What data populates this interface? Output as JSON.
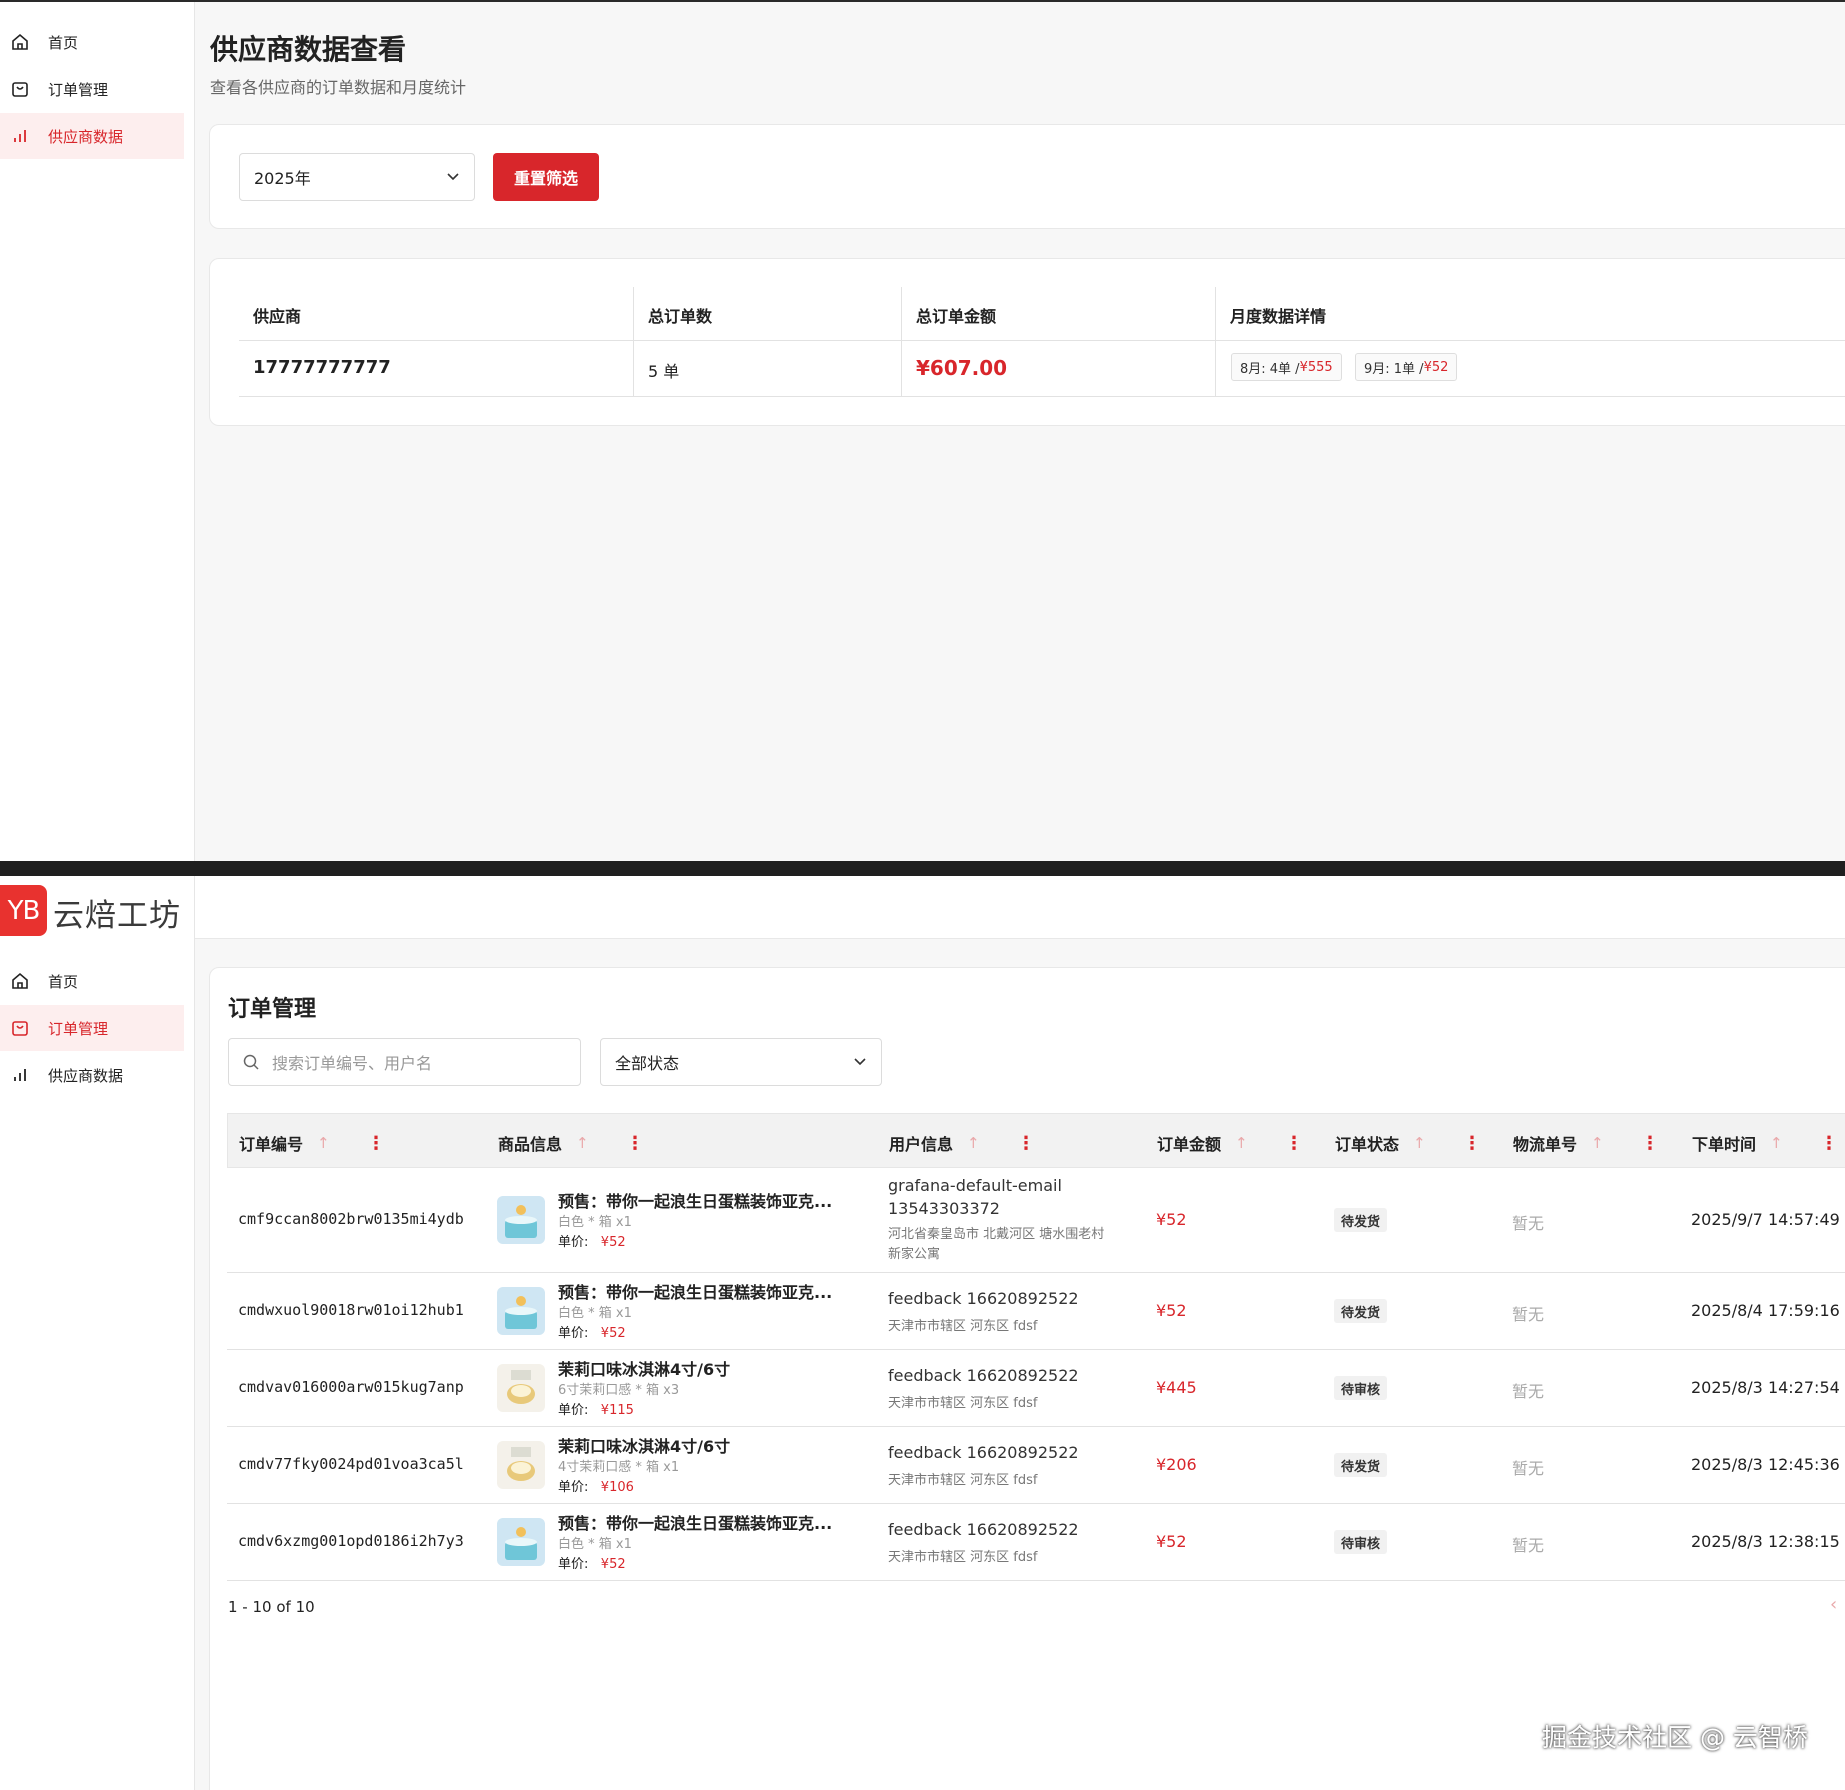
{
  "colors": {
    "accent": "#d8262b",
    "logo": "#e8322f"
  },
  "sidebar": {
    "logo_badge": "YB",
    "logo_text": "云焙工坊",
    "items": [
      {
        "label": "首页",
        "icon": "home-icon"
      },
      {
        "label": "订单管理",
        "icon": "shopping-bag-icon"
      },
      {
        "label": "供应商数据",
        "icon": "bar-chart-icon"
      }
    ]
  },
  "supplier_page": {
    "title": "供应商数据查看",
    "subtitle": "查看各供应商的订单数据和月度统计",
    "year_select": "2025年",
    "reset_button": "重置筛选",
    "columns": [
      "供应商",
      "总订单数",
      "总订单金额",
      "月度数据详情"
    ],
    "rows": [
      {
        "supplier": "17777777777",
        "total_orders": "5 单",
        "total_amount": "¥607.00",
        "monthly": [
          {
            "label": "8月: 4单 / ",
            "amount": "¥555"
          },
          {
            "label": "9月: 1单 / ",
            "amount": "¥52"
          }
        ]
      }
    ]
  },
  "order_page": {
    "title": "订单管理",
    "search_placeholder": "搜索订单编号、用户名",
    "status_select": "全部状态",
    "columns": [
      "订单编号",
      "商品信息",
      "用户信息",
      "订单金额",
      "订单状态",
      "物流单号",
      "下单时间"
    ],
    "rows": [
      {
        "id": "cmf9ccan8002brw0135mi4ydb",
        "product": "预售：带你一起浪生日蛋糕装饰亚克...",
        "variant": "白色 * 箱 x1",
        "price_label": "单价:",
        "price": "¥52",
        "user": "grafana-default-email",
        "phone": "13543303372",
        "address": "河北省秦皇岛市 北戴河区 塘水围老村",
        "address2": "新家公寓",
        "amount": "¥52",
        "status": "待发货",
        "logistics": "暂无",
        "time": "2025/9/7 14:57:49"
      },
      {
        "id": "cmdwxuol90018rw01oi12hub1",
        "product": "预售：带你一起浪生日蛋糕装饰亚克...",
        "variant": "白色 * 箱 x1",
        "price_label": "单价:",
        "price": "¥52",
        "user": "feedback 16620892522",
        "address": "天津市市辖区 河东区 fdsf",
        "amount": "¥52",
        "status": "待发货",
        "logistics": "暂无",
        "time": "2025/8/4 17:59:16"
      },
      {
        "id": "cmdvav016000arw015kug7anp",
        "product": "茉莉口味冰淇淋4寸/6寸",
        "variant": "6寸茉莉口感 * 箱 x3",
        "price_label": "单价:",
        "price": "¥115",
        "user": "feedback 16620892522",
        "address": "天津市市辖区 河东区 fdsf",
        "amount": "¥445",
        "status": "待审核",
        "logistics": "暂无",
        "time": "2025/8/3 14:27:54"
      },
      {
        "id": "cmdv77fky0024pd01voa3ca5l",
        "product": "茉莉口味冰淇淋4寸/6寸",
        "variant": "4寸茉莉口感 * 箱 x1",
        "price_label": "单价:",
        "price": "¥106",
        "user": "feedback 16620892522",
        "address": "天津市市辖区 河东区 fdsf",
        "amount": "¥206",
        "status": "待发货",
        "logistics": "暂无",
        "time": "2025/8/3 12:45:36"
      },
      {
        "id": "cmdv6xzmg001opd0186i2h7y3",
        "product": "预售：带你一起浪生日蛋糕装饰亚克...",
        "variant": "白色 * 箱 x1",
        "price_label": "单价:",
        "price": "¥52",
        "user": "feedback 16620892522",
        "address": "天津市市辖区 河东区 fdsf",
        "amount": "¥52",
        "status": "待审核",
        "logistics": "暂无",
        "time": "2025/8/3 12:38:15"
      }
    ],
    "pagination": "1 - 10 of 10"
  },
  "watermark": "掘金技术社区 @ 云智桥"
}
